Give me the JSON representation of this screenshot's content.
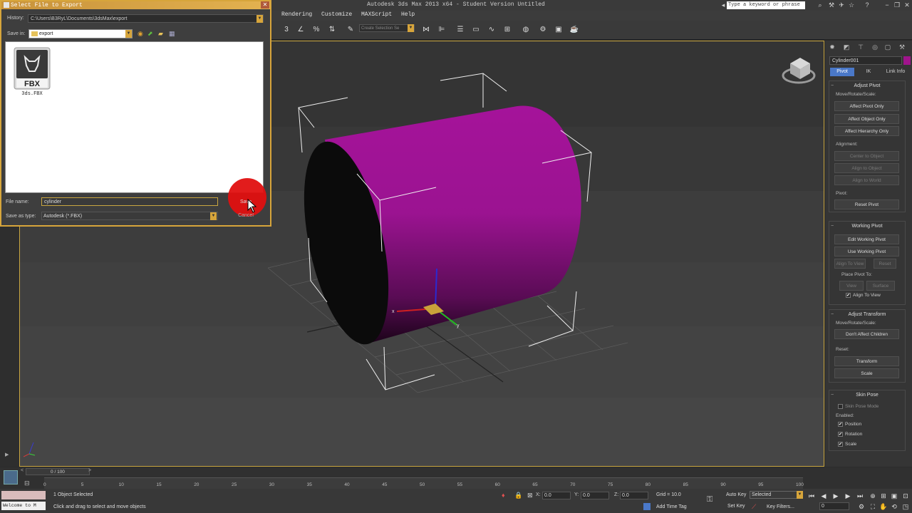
{
  "app": {
    "title": "Autodesk 3ds Max  2013 x64  - Student Version   Untitled",
    "search_placeholder": "Type a keyword or phrase"
  },
  "menu": [
    "Rendering",
    "Customize",
    "MAXScript",
    "Help"
  ],
  "toolbar": {
    "selection_set": "Create Selection Se"
  },
  "dialog": {
    "title": "Select File to Export",
    "history_label": "History:",
    "history_value": "C:\\Users\\B3RyL\\Documents\\3dsMax\\export",
    "save_in_label": "Save in:",
    "save_in_value": "export",
    "file_item": {
      "badge": "FBX",
      "name": "3ds.FBX"
    },
    "file_name_label": "File name:",
    "file_name_value": "cylinder",
    "save_type_label": "Save as type:",
    "save_type_value": "Autodesk (*.FBX)",
    "save_button": "Save",
    "cancel_button": "Cancel"
  },
  "command_panel": {
    "object_name": "Cylinder001",
    "object_color": "#a0148c",
    "subtabs": [
      "Pivot",
      "IK",
      "Link Info"
    ],
    "adjust_pivot": {
      "title": "Adjust Pivot",
      "move_label": "Move/Rotate/Scale:",
      "btn1": "Affect Pivot Only",
      "btn2": "Affect Object Only",
      "btn3": "Affect Hierarchy Only",
      "align_label": "Alignment:",
      "btn4": "Center to Object",
      "btn5": "Align to Object",
      "btn6": "Align to World",
      "pivot_label": "Pivot:",
      "btn7": "Reset Pivot"
    },
    "working_pivot": {
      "title": "Working Pivot",
      "btn1": "Edit Working Pivot",
      "btn2": "Use Working Pivot",
      "btn3": "Align To View",
      "btn4": "Reset",
      "place_label": "Place Pivot To:",
      "btn5": "View",
      "btn6": "Surface",
      "chk1": "Align To View"
    },
    "adjust_transform": {
      "title": "Adjust Transform",
      "move_label": "Move/Rotate/Scale:",
      "btn1": "Don't Affect Children",
      "reset_label": "Reset:",
      "btn2": "Transform",
      "btn3": "Scale"
    },
    "skin_pose": {
      "title": "Skin Pose",
      "chk_mode": "Skin Pose Mode",
      "enabled_label": "Enabled:",
      "chk1": "Position",
      "chk2": "Rotation",
      "chk3": "Scale"
    }
  },
  "timeline": {
    "frame": "0 / 100",
    "ticks": [
      "0",
      "5",
      "10",
      "15",
      "20",
      "25",
      "30",
      "35",
      "40",
      "45",
      "50",
      "55",
      "60",
      "65",
      "70",
      "75",
      "80",
      "85",
      "90",
      "95",
      "100"
    ]
  },
  "status": {
    "welcome": "Welcome to M",
    "selected": "1 Object Selected",
    "prompt": "Click and drag to select and move objects",
    "x_label": "X:",
    "x": "0.0",
    "y_label": "Y:",
    "y": "0.0",
    "z_label": "Z:",
    "z": "0.0",
    "grid": "Grid = 10.0",
    "add_time_tag": "Add Time Tag",
    "auto_key": "Auto Key",
    "set_key": "Set Key",
    "key_mode": "Selected",
    "key_filters": "Key Filters...",
    "frame_field": "0"
  }
}
